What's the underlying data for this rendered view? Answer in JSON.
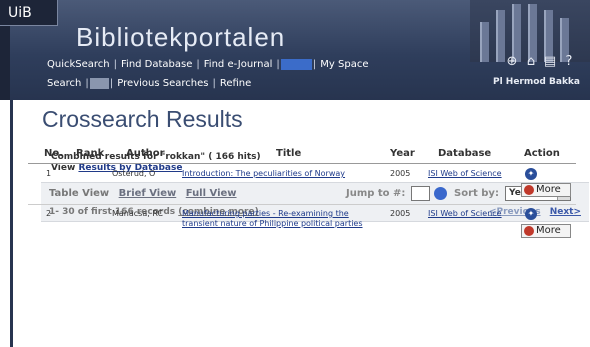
{
  "header": {
    "logo_text": "UiB",
    "portal_title": "Bibliotekportalen",
    "user_name": "Pl Hermod Bakka",
    "icons": [
      "help-globe-icon",
      "library-building-icon",
      "document-icon",
      "question-icon"
    ]
  },
  "nav": {
    "row1": [
      {
        "label": "QuickSearch",
        "active": false
      },
      {
        "label": "Find Database",
        "active": false
      },
      {
        "label": "Find e-Journal",
        "active": false
      },
      {
        "label": "",
        "active": true
      },
      {
        "label": "My Space",
        "active": false
      }
    ],
    "row2": [
      {
        "label": "Search",
        "active": false
      },
      {
        "label": "",
        "active": true
      },
      {
        "label": "Previous Searches",
        "active": false
      },
      {
        "label": "Refine",
        "active": false
      }
    ]
  },
  "page": {
    "title": "Crossearch Results",
    "combined_prefix": "Combined results for \"rokkan\" ( 166 hits)",
    "view_prefix": "View",
    "view_link": "Results by Database"
  },
  "toolbar": {
    "table_view": "Table View",
    "brief_view": "Brief View",
    "full_view": "Full View",
    "jump_label": "Jump to #:",
    "jump_value": "",
    "sort_label": "Sort by:",
    "sort_value": "Year",
    "records_text": "1- 30 of first 166 records",
    "combine_more": "(combine more)",
    "prev": "<Previous",
    "next": "Next>"
  },
  "table": {
    "headers": [
      "No.",
      "Rank",
      "Author",
      "Title",
      "Year",
      "Database",
      "Action"
    ],
    "rows": [
      {
        "no": "1",
        "rank": "",
        "author": "Osterud, O",
        "title": "Introduction: The peculiarities of Norway",
        "year": "2005",
        "database": "ISI Web of Science",
        "more": "More"
      },
      {
        "no": "2",
        "rank": "",
        "author": "Manacsa, RC",
        "title": "Manufacturing parties - Re-examining the transient nature of Philippine political parties",
        "year": "2005",
        "database": "ISI Web of Science",
        "more": "More"
      }
    ]
  },
  "colors": {
    "banner": "#2f3e5c",
    "title": "#3a4d72",
    "link": "#1e3a8a",
    "active_tab": "#3b6cc9"
  }
}
